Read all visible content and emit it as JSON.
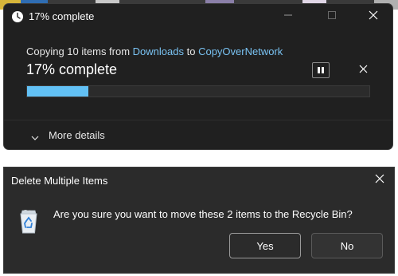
{
  "colors": {
    "window_bg": "#202020",
    "dialog_bg": "#2b2b2b",
    "accent_link": "#79c2f2",
    "progress_fill": "#62c1f5"
  },
  "copy_window": {
    "title": "17% complete",
    "title_icon": "clock-icon",
    "controls": {
      "minimize_icon": "minimize-icon",
      "maximize_icon": "maximize-icon",
      "close_icon": "close-icon"
    },
    "description": {
      "prefix": "Copying 10 items from ",
      "source": "Downloads",
      "middle": " to ",
      "destination": "CopyOverNetwork"
    },
    "percent_label": "17% complete",
    "progress_fraction": 0.18,
    "pause_icon": "pause-icon",
    "cancel_icon": "close-icon",
    "more_details_label": "More details",
    "more_details_icon": "chevron-down-icon"
  },
  "delete_dialog": {
    "title": "Delete Multiple Items",
    "close_icon": "close-icon",
    "icon": "recycle-bin-icon",
    "question": "Are you sure you want to move these 2 items to the Recycle Bin?",
    "yes_label": "Yes",
    "no_label": "No"
  }
}
